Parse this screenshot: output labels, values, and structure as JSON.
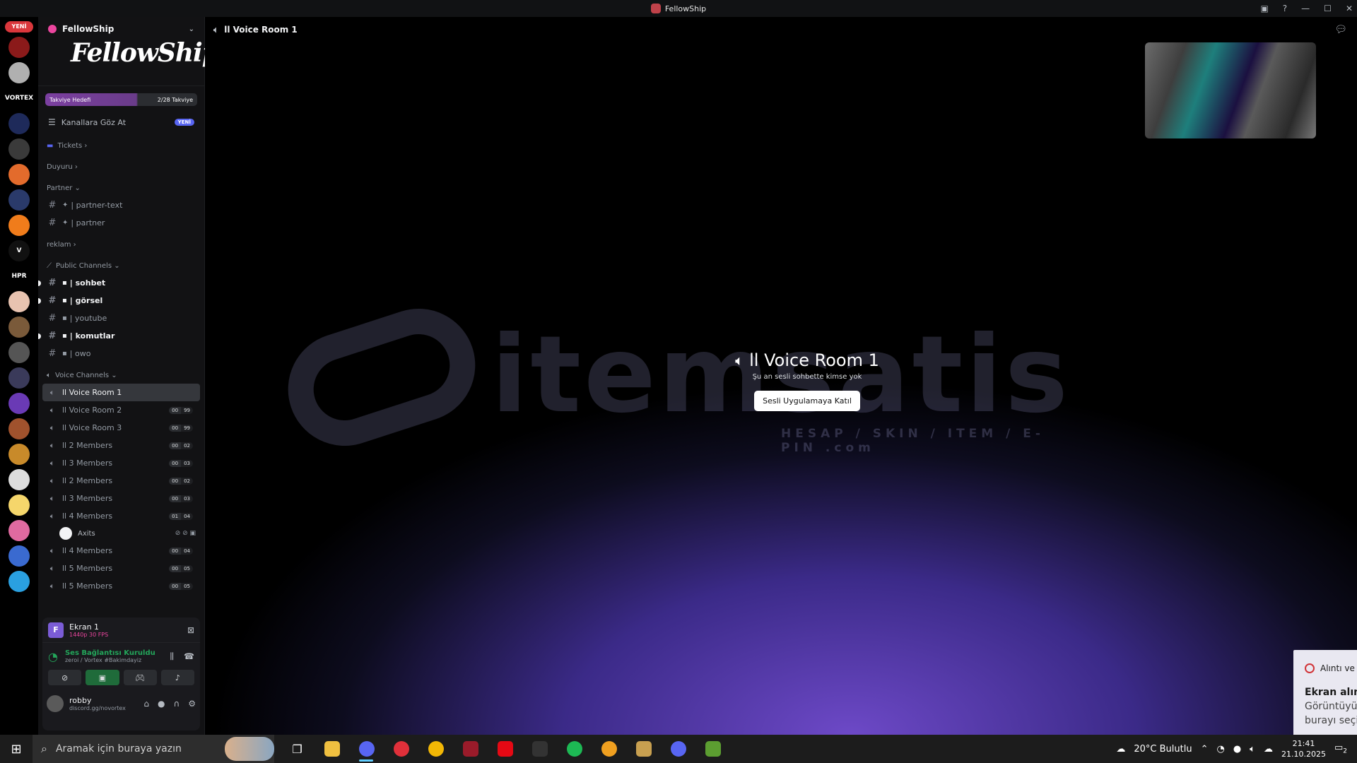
{
  "window": {
    "title": "FellowShip"
  },
  "guilds": {
    "new_badge": "YENİ",
    "items": [
      {
        "label": "",
        "color": "#8b1a1a"
      },
      {
        "label": "",
        "color": "#b0b0b0"
      },
      {
        "label": "VORTEX",
        "color": "#000000"
      },
      {
        "label": "",
        "color": "#1e2a5a"
      },
      {
        "label": "",
        "color": "#3a3a3a"
      },
      {
        "label": "",
        "color": "#e36b2c"
      },
      {
        "label": "",
        "color": "#2a3a6a"
      },
      {
        "label": "",
        "color": "#f07c1b"
      },
      {
        "label": "V",
        "color": "#111111"
      },
      {
        "label": "HPR",
        "color": "#000000"
      },
      {
        "label": "",
        "color": "#e8c3b0"
      },
      {
        "label": "",
        "color": "#7a5a3a"
      },
      {
        "label": "",
        "color": "#555555"
      },
      {
        "label": "",
        "color": "#3a3a5a"
      },
      {
        "label": "",
        "color": "#6a3ab5"
      },
      {
        "label": "",
        "color": "#a0522d"
      },
      {
        "label": "",
        "color": "#c88a2a"
      },
      {
        "label": "",
        "color": "#dddddd"
      },
      {
        "label": "",
        "color": "#f5d66b"
      },
      {
        "label": "",
        "color": "#e06aa0"
      },
      {
        "label": "",
        "color": "#3a6ad0"
      },
      {
        "label": "",
        "color": "#2aa0e0"
      }
    ]
  },
  "sidebar": {
    "server_name": "FellowShip",
    "banner_text": "FellowShip",
    "boost_goal_label": "Takviye Hedefi",
    "boost_count": "2/28 Takviye",
    "browse_label": "Kanallara Göz At",
    "browse_badge": "YENİ",
    "categories": {
      "tickets": "Tickets",
      "duyuru": "Duyuru",
      "partner": "Partner",
      "reklam": "reklam",
      "public": "Public Channels",
      "voice": "Voice Channels"
    },
    "partner_channels": [
      {
        "name": "| partner-text"
      },
      {
        "name": "| partner"
      }
    ],
    "public_channels": [
      {
        "name": "| sohbet",
        "unread": true
      },
      {
        "name": "| görsel",
        "unread": true
      },
      {
        "name": "| youtube",
        "unread": false
      },
      {
        "name": "| komutlar",
        "unread": true
      },
      {
        "name": "| owo",
        "unread": false
      }
    ],
    "voice_channels": [
      {
        "name": "ll Voice Room 1",
        "a": "",
        "b": "",
        "active": true
      },
      {
        "name": "ll Voice Room 2",
        "a": "00",
        "b": "99"
      },
      {
        "name": "ll Voice Room 3",
        "a": "00",
        "b": "99"
      },
      {
        "name": "ll 2 Members",
        "a": "00",
        "b": "02"
      },
      {
        "name": "ll 3 Members",
        "a": "00",
        "b": "03"
      },
      {
        "name": "ll 2 Members",
        "a": "00",
        "b": "02"
      },
      {
        "name": "ll 3 Members",
        "a": "00",
        "b": "03"
      },
      {
        "name": "ll 4 Members",
        "a": "01",
        "b": "04"
      }
    ],
    "member_in_voice": "Axits",
    "voice_channels_after": [
      {
        "name": "ll 4 Members",
        "a": "00",
        "b": "04"
      },
      {
        "name": "ll 5 Members",
        "a": "00",
        "b": "05"
      },
      {
        "name": "ll 5 Members",
        "a": "00",
        "b": "05"
      }
    ],
    "panel": {
      "stream_title": "Ekran 1",
      "stream_quality": "1440p 30 FPS",
      "voice_status": "Ses Bağlantısı Kuruldu",
      "voice_location": "zeroi / Vortex #Bakimdayiz",
      "user_name": "robby",
      "user_status": "discord.gg/novortex"
    }
  },
  "main": {
    "header_channel": "ll Voice Room 1",
    "center_title": "ll Voice Room 1",
    "center_subtitle": "Şu an sesli sohbette kimse yok",
    "join_button": "Sesli Uygulamaya Katıl",
    "watermark_main": "itemsatis",
    "watermark_sub": "HESAP / SKIN / ITEM / E-PIN .com"
  },
  "toast": {
    "app": "Alıntı ve Taslak",
    "title": "Ekran alıntısı panoya kaydedildi",
    "body": "Görüntüyü işaretlemek ve paylaşmak için burayı seçin"
  },
  "taskbar": {
    "search_placeholder": "Aramak için buraya yazın",
    "weather": "20°C  Bulutlu",
    "time": "21:41",
    "date": "21.10.2025",
    "notif_count": "2"
  }
}
